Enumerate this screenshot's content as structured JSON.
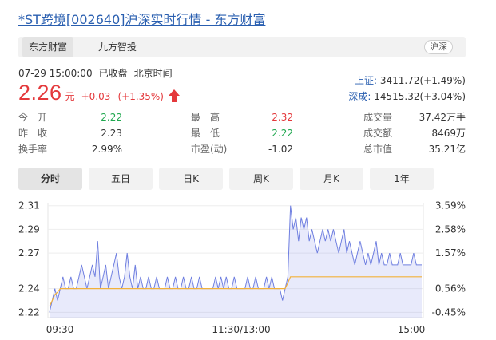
{
  "title": "*ST跨境[002640]沪深实时行情 - 东方财富",
  "tabs": [
    "东方财富",
    "九方智投"
  ],
  "market_badge": "沪深",
  "datetime": "07-29 15:00:00",
  "status": "已收盘",
  "timezone": "北京时间",
  "price": "2.26",
  "price_unit": "元",
  "change": "+0.03",
  "change_pct": "(+1.35%)",
  "indices": [
    {
      "name": "上证:",
      "value": "3411.72(+1.49%)"
    },
    {
      "name": "深成:",
      "value": "14515.32(+3.04%)"
    }
  ],
  "stats": [
    [
      {
        "label": "今　开",
        "value": "2.22",
        "color": "green"
      },
      {
        "label": "最　高",
        "value": "2.32",
        "color": "red"
      },
      {
        "label": "成交量",
        "value": "37.42万手",
        "color": ""
      }
    ],
    [
      {
        "label": "昨　收",
        "value": "2.23",
        "color": ""
      },
      {
        "label": "最　低",
        "value": "2.22",
        "color": "green"
      },
      {
        "label": "成交额",
        "value": "8469万",
        "color": ""
      }
    ],
    [
      {
        "label": "换手率",
        "value": "2.99%",
        "color": ""
      },
      {
        "label": "市盈(动)",
        "value": "-1.02",
        "color": ""
      },
      {
        "label": "总市值",
        "value": "35.21亿",
        "color": ""
      }
    ]
  ],
  "chart_tabs": [
    "分时",
    "五日",
    "日K",
    "周K",
    "月K",
    "1年"
  ],
  "colors": {
    "up": "#e4393c",
    "down": "#1fa84f",
    "link": "#2a5fb0",
    "price_line": "#6f7fe0",
    "avg_line": "#f2b13a"
  },
  "chart_data": {
    "type": "line",
    "title": "",
    "xlabel": "",
    "ylabel": "",
    "ylim": [
      2.2155,
      2.3125
    ],
    "y_ticks": [
      "2.31",
      "2.29",
      "2.27",
      "2.24",
      "2.22"
    ],
    "y_tick_values": [
      2.31,
      2.29,
      2.27,
      2.24,
      2.22
    ],
    "pct_ticks": [
      "3.59%",
      "2.58%",
      "1.57%",
      "0.56%",
      "-0.45%"
    ],
    "x_ticks": [
      "09:30",
      "11:30/13:00",
      "15:00"
    ],
    "series": [
      {
        "name": "",
        "values": [
          2.22,
          2.23,
          2.24,
          2.23,
          2.24,
          2.25,
          2.24,
          2.24,
          2.25,
          2.24,
          2.24,
          2.25,
          2.26,
          2.25,
          2.24,
          2.25,
          2.26,
          2.25,
          2.28,
          2.24,
          2.25,
          2.26,
          2.24,
          2.25,
          2.26,
          2.27,
          2.25,
          2.24,
          2.25,
          2.27,
          2.25,
          2.24,
          2.26,
          2.24,
          2.25,
          2.24,
          2.24,
          2.25,
          2.24,
          2.24,
          2.25,
          2.24,
          2.24,
          2.24,
          2.25,
          2.24,
          2.24,
          2.25,
          2.24,
          2.24,
          2.25,
          2.24,
          2.24,
          2.25,
          2.24,
          2.24,
          2.25,
          2.24,
          2.24,
          2.24,
          2.24,
          2.24,
          2.25,
          2.24,
          2.25,
          2.24,
          2.25,
          2.24,
          2.24,
          2.25,
          2.24,
          2.24,
          2.24,
          2.24,
          2.25,
          2.24,
          2.24,
          2.25,
          2.24,
          2.24,
          2.24,
          2.25,
          2.24,
          2.25,
          2.24,
          2.24,
          2.24,
          2.23,
          2.24,
          2.25,
          2.31,
          2.29,
          2.3,
          2.28,
          2.3,
          2.29,
          2.3,
          2.28,
          2.29,
          2.28,
          2.27,
          2.28,
          2.29,
          2.28,
          2.29,
          2.28,
          2.29,
          2.28,
          2.27,
          2.28,
          2.29,
          2.27,
          2.28,
          2.27,
          2.26,
          2.27,
          2.28,
          2.27,
          2.26,
          2.27,
          2.26,
          2.27,
          2.28,
          2.26,
          2.27,
          2.26,
          2.26,
          2.27,
          2.26,
          2.26,
          2.26,
          2.27,
          2.26,
          2.26,
          2.26,
          2.26,
          2.27,
          2.26,
          2.26,
          2.26
        ]
      },
      {
        "name": "",
        "values": [
          2.225,
          2.23,
          2.235,
          2.237,
          2.24,
          2.24,
          2.24,
          2.24,
          2.24,
          2.24,
          2.24,
          2.24,
          2.24,
          2.24,
          2.24,
          2.24,
          2.24,
          2.24,
          2.24,
          2.24,
          2.24,
          2.24,
          2.24,
          2.24,
          2.24,
          2.24,
          2.24,
          2.24,
          2.24,
          2.24,
          2.24,
          2.24,
          2.24,
          2.24,
          2.24,
          2.24,
          2.24,
          2.24,
          2.24,
          2.24,
          2.24,
          2.24,
          2.24,
          2.24,
          2.24,
          2.24,
          2.24,
          2.24,
          2.24,
          2.24,
          2.24,
          2.24,
          2.24,
          2.24,
          2.24,
          2.24,
          2.24,
          2.24,
          2.24,
          2.24,
          2.24,
          2.24,
          2.24,
          2.24,
          2.24,
          2.24,
          2.24,
          2.24,
          2.24,
          2.24,
          2.24,
          2.24,
          2.24,
          2.24,
          2.24,
          2.24,
          2.24,
          2.24,
          2.24,
          2.24,
          2.24,
          2.24,
          2.24,
          2.24,
          2.24,
          2.24,
          2.24,
          2.24,
          2.24,
          2.245,
          2.25,
          2.25,
          2.25,
          2.25,
          2.25,
          2.25,
          2.25,
          2.25,
          2.25,
          2.25,
          2.25,
          2.25,
          2.25,
          2.25,
          2.25,
          2.25,
          2.25,
          2.25,
          2.25,
          2.25,
          2.25,
          2.25,
          2.25,
          2.25,
          2.25,
          2.25,
          2.25,
          2.25,
          2.25,
          2.25,
          2.25,
          2.25,
          2.25,
          2.25,
          2.25,
          2.25,
          2.25,
          2.25,
          2.25,
          2.25,
          2.25,
          2.25,
          2.25,
          2.25,
          2.25,
          2.25,
          2.25,
          2.25,
          2.25,
          2.25
        ]
      }
    ]
  }
}
